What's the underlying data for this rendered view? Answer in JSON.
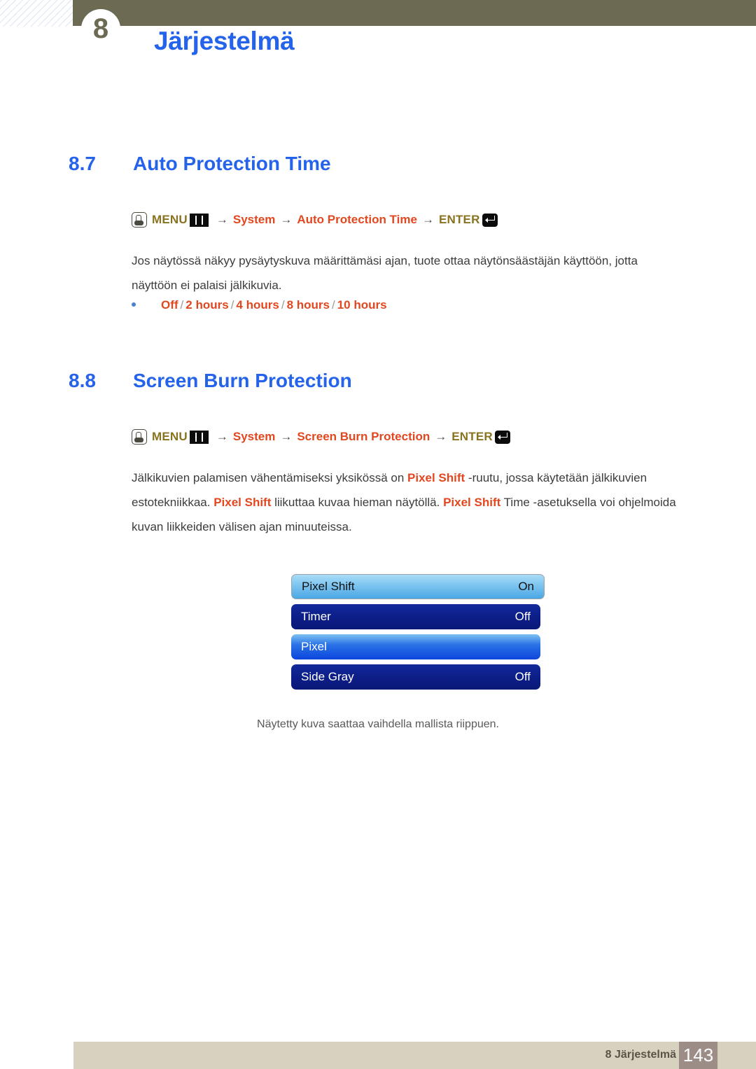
{
  "header": {
    "chapter_number": "8",
    "title": "Järjestelmä"
  },
  "sections": [
    {
      "number": "8.7",
      "title": "Auto Protection Time",
      "menu_path": {
        "hand_icon": "hand-press-icon",
        "menu_label": "MENU",
        "menu_icon": "menu-bars-icon",
        "arrow": "→",
        "items": [
          "System",
          "Auto Protection Time"
        ],
        "enter_label": "ENTER",
        "enter_icon": "enter-return-icon"
      },
      "paragraph": "Jos näytössä näkyy pysäytyskuva määrittämäsi ajan, tuote ottaa näytönsäästäjän käyttöön, jotta näyttöön ei palaisi jälkikuvia.",
      "bullet": {
        "options": [
          "Off",
          "2 hours",
          "4 hours",
          "8 hours",
          "10 hours"
        ],
        "separator": "/"
      }
    },
    {
      "number": "8.8",
      "title": "Screen Burn Protection",
      "menu_path": {
        "hand_icon": "hand-press-icon",
        "menu_label": "MENU",
        "menu_icon": "menu-bars-icon",
        "arrow": "→",
        "items": [
          "System",
          "Screen Burn Protection"
        ],
        "enter_label": "ENTER",
        "enter_icon": "enter-return-icon"
      },
      "paragraph_parts": [
        {
          "text": "Jälkikuvien palamisen vähentämiseksi yksikössä on ",
          "bold": false
        },
        {
          "text": "Pixel Shift",
          "bold": true
        },
        {
          "text": " -ruutu, jossa käytetään jälkikuvien estotekniikkaa. ",
          "bold": false
        },
        {
          "text": "Pixel Shift",
          "bold": true
        },
        {
          "text": " liikuttaa kuvaa hieman näytöllä. ",
          "bold": false
        },
        {
          "text": "Pixel Shift",
          "bold": true
        },
        {
          "text": " Time -asetuksella voi ohjelmoida kuvan liikkeiden välisen ajan minuuteissa.",
          "bold": false
        }
      ]
    }
  ],
  "osd": {
    "rows": [
      {
        "label": "Pixel Shift",
        "value": "On",
        "style": "selected"
      },
      {
        "label": "Timer",
        "value": "Off",
        "style": "dark"
      },
      {
        "label": "Pixel",
        "value": "",
        "style": "bright"
      },
      {
        "label": "Side Gray",
        "value": "Off",
        "style": "dark"
      }
    ],
    "caption": "Näytetty kuva saattaa vaihdella mallista riippuen."
  },
  "footer": {
    "label": "8 Järjestelmä",
    "page_number": "143"
  },
  "colors": {
    "heading_blue": "#2563eb",
    "keyword_orange": "#e2471f",
    "menu_gold": "#8a7320",
    "header_olive": "#6d6a54",
    "footer_beige": "#d7d2c0",
    "footer_page_block": "#9d8d87"
  }
}
